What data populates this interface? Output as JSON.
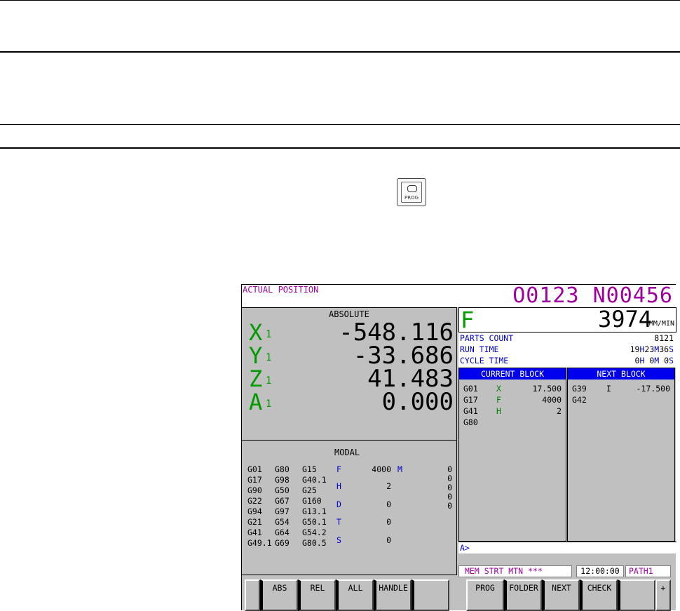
{
  "prog_key": {
    "label": "PROG"
  },
  "screen": {
    "title": "ACTUAL POSITION",
    "program": "O0123 N00456",
    "position": {
      "label": "ABSOLUTE",
      "axes": [
        {
          "name": "X",
          "sub": "1",
          "value": "-548.116"
        },
        {
          "name": "Y",
          "sub": "1",
          "value": "-33.686"
        },
        {
          "name": "Z",
          "sub": "1",
          "value": "41.483"
        },
        {
          "name": "A",
          "sub": "1",
          "value": "0.000"
        }
      ]
    },
    "modal": {
      "label": "MODAL",
      "gcodes": [
        [
          "G01",
          "G80",
          "G15"
        ],
        [
          "G17",
          "G98",
          "G40.1"
        ],
        [
          "G90",
          "G50",
          "G25"
        ],
        [
          "G22",
          "G67",
          "G160"
        ],
        [
          "G94",
          "G97",
          "G13.1"
        ],
        [
          "G21",
          "G54",
          "G50.1"
        ],
        [
          "G41",
          "G64",
          "G54.2"
        ],
        [
          "G49.1",
          "G69",
          "G80.5"
        ]
      ],
      "addr": [
        {
          "key": "F",
          "value": "4000"
        },
        {
          "key": "H",
          "value": "2"
        },
        {
          "key": "D",
          "value": "0"
        },
        {
          "key": "T",
          "value": "0"
        },
        {
          "key": "S",
          "value": "0"
        }
      ],
      "m_key": "M",
      "m_values": [
        "0",
        "0",
        "0",
        "0",
        "0"
      ]
    },
    "feed": {
      "label": "F",
      "value": "3974",
      "unit": "MM/MIN"
    },
    "info": {
      "parts_count_label": "PARTS COUNT",
      "parts_count": "8121",
      "run_time_label": "RUN TIME",
      "run_time": {
        "h": "19",
        "m": "23",
        "s": "36"
      },
      "cycle_time_label": "CYCLE TIME",
      "cycle_time": {
        "h": "0",
        "m": "0",
        "s": "0"
      },
      "h_letter": "H",
      "m_letter": "M",
      "s_letter": "S"
    },
    "current_block": {
      "label": "CURRENT BLOCK",
      "rows": [
        {
          "g": "G01",
          "addr": "X",
          "value": "17.500"
        },
        {
          "g": "G17",
          "addr": "F",
          "value": "4000"
        },
        {
          "g": "G41",
          "addr": "H",
          "value": "2"
        },
        {
          "g": "G80",
          "addr": "",
          "value": ""
        }
      ]
    },
    "next_block": {
      "label": "NEXT BLOCK",
      "rows": [
        {
          "g": "G39",
          "addr": "I",
          "value": "-17.500"
        },
        {
          "g": "G42",
          "addr": "",
          "value": ""
        }
      ]
    },
    "input_prompt": "A>",
    "status": {
      "mode": "MEM STRT MTN ***",
      "clock": "12:00:00",
      "path": "PATH1"
    },
    "softkeys": {
      "left": [
        "ABS",
        "REL",
        "ALL",
        "HANDLE",
        ""
      ],
      "right": [
        "PROG",
        "FOLDER",
        "NEXT",
        "CHECK",
        "",
        "+"
      ]
    }
  }
}
